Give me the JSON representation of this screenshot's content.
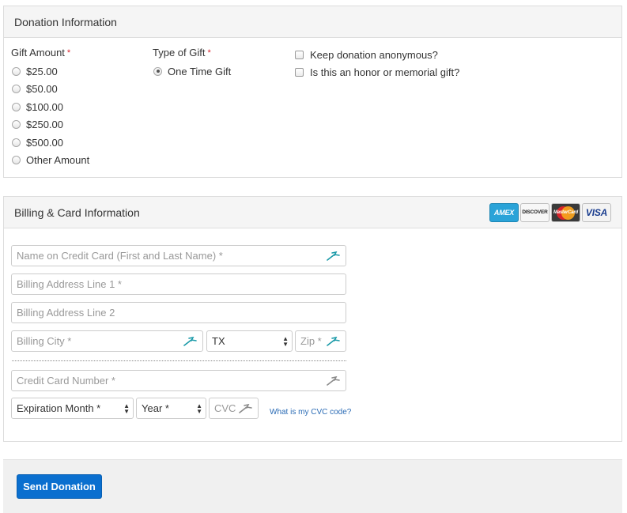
{
  "donation": {
    "heading": "Donation Information",
    "gift_amount": {
      "label": "Gift Amount",
      "required_mark": "*",
      "options": [
        "$25.00",
        "$50.00",
        "$100.00",
        "$250.00",
        "$500.00",
        "Other Amount"
      ],
      "selected": null
    },
    "gift_type": {
      "label": "Type of Gift",
      "required_mark": "*",
      "options": [
        "One Time Gift"
      ],
      "selected": "One Time Gift"
    },
    "checkboxes": [
      {
        "label": "Keep donation anonymous?",
        "checked": false
      },
      {
        "label": "Is this an honor or memorial gift?",
        "checked": false
      }
    ]
  },
  "billing": {
    "heading": "Billing & Card Information",
    "card_logos": {
      "amex": "AMEX",
      "discover": "DISCOVER",
      "mastercard": "MasterCard",
      "visa": "VISA"
    },
    "fields": {
      "name_on_card": {
        "placeholder": "Name on Credit Card (First and Last Name) *",
        "value": ""
      },
      "address1": {
        "placeholder": "Billing Address Line 1 *",
        "value": ""
      },
      "address2": {
        "placeholder": "Billing Address Line 2",
        "value": ""
      },
      "city": {
        "placeholder": "Billing City *",
        "value": ""
      },
      "state": {
        "value": "TX"
      },
      "zip": {
        "placeholder": "Zip *",
        "value": ""
      },
      "card_number": {
        "placeholder": "Credit Card Number *",
        "value": ""
      },
      "exp_month": {
        "value": "Expiration Month *"
      },
      "exp_year": {
        "value": "Year *"
      },
      "cvc": {
        "placeholder": "CVC *",
        "value": ""
      }
    },
    "cvc_help_link": "What is my CVC code?"
  },
  "footer": {
    "submit_label": "Send Donation"
  },
  "colors": {
    "primary_button": "#0a6fcf",
    "required_asterisk": "#d9232d",
    "link": "#2a6bb5",
    "autofill_icon_teal": "#1a9aa8"
  }
}
